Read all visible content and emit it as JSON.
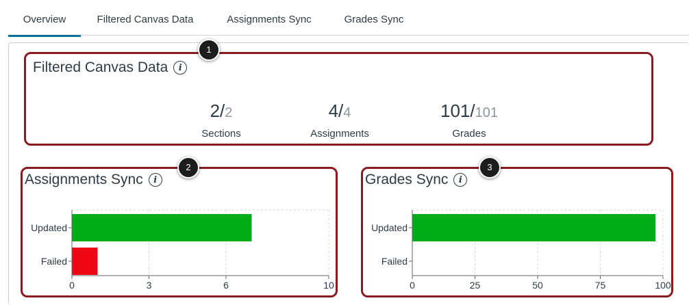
{
  "tabs": [
    {
      "label": "Overview",
      "active": true
    },
    {
      "label": "Filtered Canvas Data",
      "active": false
    },
    {
      "label": "Assignments Sync",
      "active": false
    },
    {
      "label": "Grades Sync",
      "active": false
    }
  ],
  "filtered_data": {
    "title": "Filtered Canvas Data",
    "badge": "1",
    "stats": [
      {
        "count": "2/",
        "total": "2",
        "label": "Sections"
      },
      {
        "count": "4/",
        "total": "4",
        "label": "Assignments"
      },
      {
        "count": "101/",
        "total": "101",
        "label": "Grades"
      }
    ]
  },
  "assignments_sync": {
    "title": "Assignments Sync",
    "badge": "2"
  },
  "grades_sync": {
    "title": "Grades Sync",
    "badge": "3"
  },
  "colors": {
    "accent": "#0770a3",
    "updated": "#00ac18",
    "failed": "#ee0612",
    "highlight": "#8b1a1f"
  },
  "chart_data": [
    {
      "type": "bar",
      "orientation": "horizontal",
      "categories": [
        "Updated",
        "Failed"
      ],
      "values": [
        7,
        1
      ],
      "colors": [
        "#00ac18",
        "#ee0612"
      ],
      "xticks": [
        0,
        3,
        6,
        10
      ],
      "xlim": [
        0,
        10
      ],
      "grid": true
    },
    {
      "type": "bar",
      "orientation": "horizontal",
      "categories": [
        "Updated",
        "Failed"
      ],
      "values": [
        97,
        0
      ],
      "colors": [
        "#00ac18",
        "#ee0612"
      ],
      "xticks": [
        0,
        25,
        50,
        75,
        100
      ],
      "xlim": [
        0,
        100
      ],
      "grid": true
    }
  ]
}
